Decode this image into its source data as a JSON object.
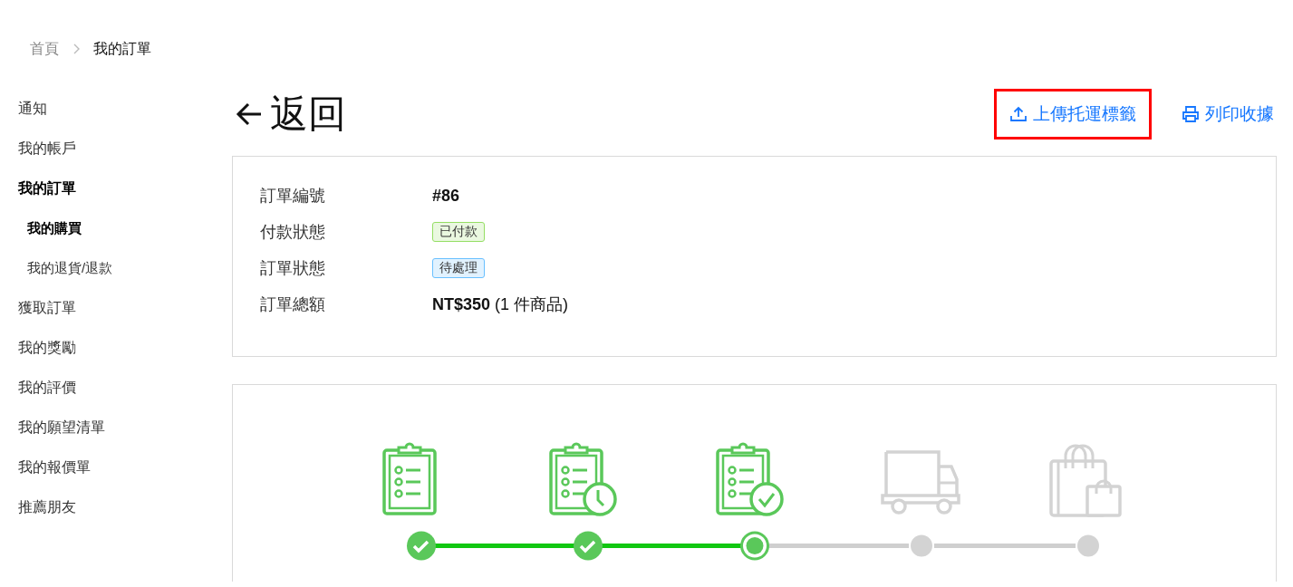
{
  "breadcrumb": [
    {
      "label": "首頁"
    },
    {
      "label": "我的訂單"
    }
  ],
  "sidebar": {
    "items": [
      {
        "label": "通知",
        "expanded": false
      },
      {
        "label": "我的帳戶",
        "expanded": false
      },
      {
        "label": "我的訂單",
        "expanded": true,
        "children": [
          {
            "label": "我的購買",
            "selected": true
          },
          {
            "label": "我的退貨/退款",
            "selected": false
          }
        ]
      },
      {
        "label": "獲取訂單",
        "expanded": false
      },
      {
        "label": "我的獎勵",
        "expanded": false
      },
      {
        "label": "我的評價",
        "expanded": false
      },
      {
        "label": "我的願望清單",
        "expanded": false
      },
      {
        "label": "我的報價單",
        "expanded": false
      },
      {
        "label": "推薦朋友",
        "expanded": false
      }
    ]
  },
  "header": {
    "back_label": "返回",
    "actions": [
      {
        "label": "上傳托運標籤",
        "kind": "upload",
        "highlighted": true
      },
      {
        "label": "列印收據",
        "kind": "print",
        "highlighted": false
      }
    ]
  },
  "order_info": {
    "rows": [
      {
        "label": "訂單編號",
        "kind": "bold",
        "value": "#86"
      },
      {
        "label": "付款狀態",
        "kind": "tag",
        "value": "已付款",
        "color": "#95de64"
      },
      {
        "label": "訂單狀態",
        "kind": "tag",
        "value": "待處理",
        "color": "#69c0ff"
      },
      {
        "label": "訂單總額",
        "kind": "rich",
        "value": "**NT$350** (1 件商品)"
      }
    ]
  },
  "progress": {
    "steps": [
      {
        "kind": "clipboard",
        "done": true,
        "current": false
      },
      {
        "kind": "clipboard-clock",
        "done": true,
        "current": false
      },
      {
        "kind": "clipboard-check",
        "done": false,
        "current": true
      },
      {
        "kind": "truck",
        "done": false,
        "current": false
      },
      {
        "kind": "bags",
        "done": false,
        "current": false
      }
    ]
  }
}
